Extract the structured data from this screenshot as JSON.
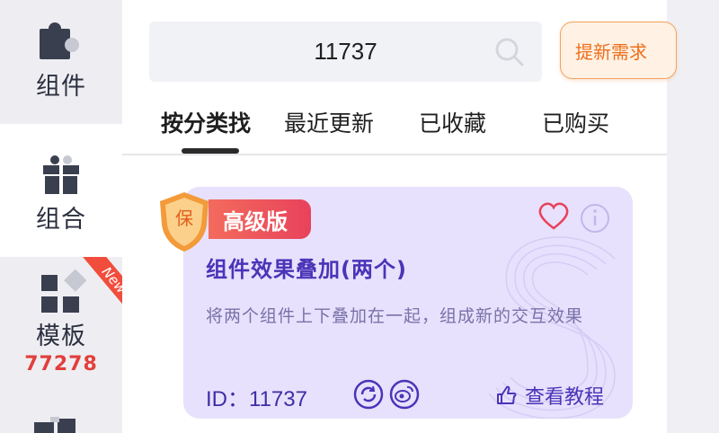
{
  "sidebar": {
    "items": [
      {
        "label": "组件",
        "icon": "puzzle-icon"
      },
      {
        "label": "组合",
        "icon": "gift-icon"
      },
      {
        "label": "模板",
        "icon": "template-grid-icon",
        "count": "77278",
        "corner": "New"
      }
    ]
  },
  "search": {
    "value": "11737"
  },
  "request_button": {
    "label": "提新需求"
  },
  "tabs": [
    "按分类找",
    "最近更新",
    "已收藏",
    "已购买"
  ],
  "card": {
    "badge": "高级版",
    "title": "组件效果叠加(两个)",
    "description": "将两个组件上下叠加在一起，组成新的交互效果",
    "id_text": "ID：11737",
    "tutorial_label": "查看教程"
  },
  "colors": {
    "accent": "#4b34b8",
    "card_bg": "#e7e1fd",
    "badge": "#e8425b",
    "request_btn": "#ee6f1a",
    "count": "#e23f3b"
  }
}
